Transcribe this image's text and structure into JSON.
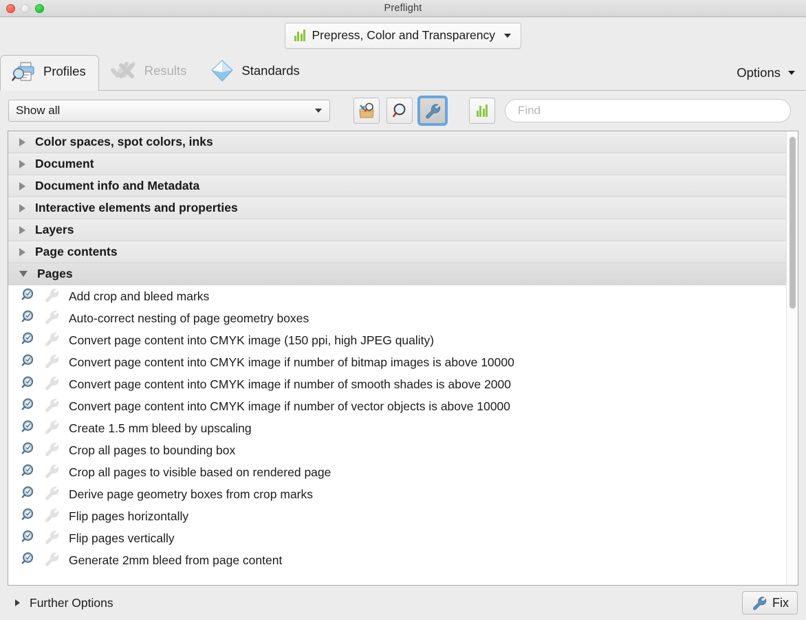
{
  "window": {
    "title": "Preflight",
    "traffic_lights": [
      "close-red",
      "minimize-disabled",
      "zoom-green"
    ]
  },
  "profile_selector": {
    "icon": "bar-chart-icon",
    "label": "Prepress, Color and Transparency",
    "caret": "chevron-down-icon"
  },
  "tabs": [
    {
      "label": "Profiles",
      "icon": "printer-magnifier-icon",
      "state": "active"
    },
    {
      "label": "Results",
      "icon": "checkmarks-icon",
      "state": "disabled"
    },
    {
      "label": "Standards",
      "icon": "diamond-icon",
      "state": "normal"
    }
  ],
  "options_menu": {
    "label": "Options",
    "caret": "chevron-down-icon"
  },
  "toolbar": {
    "filter_select": {
      "value": "Show all",
      "caret": "chevron-down-icon"
    },
    "buttons": [
      {
        "name": "toolbox-inspect-icon",
        "selected": false
      },
      {
        "name": "magnifier-icon",
        "selected": false
      },
      {
        "name": "wrench-icon",
        "selected": true
      }
    ],
    "chart_button": {
      "icon": "bar-chart-icon"
    },
    "find": {
      "placeholder": "Find",
      "value": ""
    }
  },
  "list": {
    "categories": [
      {
        "label": "Color spaces, spot colors, inks",
        "expanded": false
      },
      {
        "label": "Document",
        "expanded": false
      },
      {
        "label": "Document info and Metadata",
        "expanded": false
      },
      {
        "label": "Interactive elements and properties",
        "expanded": false
      },
      {
        "label": "Layers",
        "expanded": false
      },
      {
        "label": "Page contents",
        "expanded": false
      },
      {
        "label": "Pages",
        "expanded": true
      }
    ],
    "items": [
      "Add crop and bleed marks",
      "Auto-correct nesting of page geometry boxes",
      "Convert page content into CMYK image (150 ppi, high JPEG quality)",
      "Convert page content into CMYK image if number of bitmap images is above 10000",
      "Convert page content into CMYK image if number of smooth shades is above 2000",
      "Convert page content into CMYK image if number of vector objects is above 10000",
      "Create 1.5 mm bleed by upscaling",
      "Crop all pages to bounding box",
      "Crop all pages to visible based on rendered page",
      "Derive page geometry boxes from crop marks",
      "Flip pages horizontally",
      "Flip pages vertically",
      "Generate 2mm bleed from page content"
    ],
    "item_icons": [
      "inspect-magnifier-icon",
      "wrench-icon"
    ],
    "scrollbar": {
      "orientation": "vertical"
    }
  },
  "bottom": {
    "further_options": {
      "label": "Further Options",
      "triangle": "triangle-right-icon"
    },
    "fix_button": {
      "label": "Fix",
      "icon": "wrench-icon"
    }
  },
  "colors": {
    "accent_blue": "#5aa7f0",
    "chart_green": "#8cc63f",
    "window_bg": "#ececec",
    "list_bg": "#ffffff",
    "icon_blue": "#6f94ad"
  }
}
